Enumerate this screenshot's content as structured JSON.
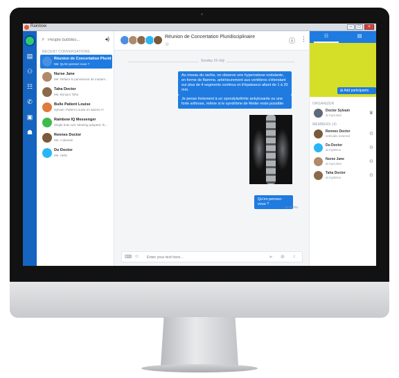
{
  "window": {
    "title": "Rainbow"
  },
  "sidebar": {
    "search_placeholder": "People bubbles...",
    "section_label": "RECENT CONVERSATIONS",
    "conversations": [
      {
        "name": "Réunion de Concertation Plurid",
        "preview": "Me: Qu'en pensez-vous ?",
        "active": true,
        "color": "#4a90e2"
      },
      {
        "name": "Nurse Jane",
        "preview": "Me: Refaire le pansement de madam...",
        "color": "#b08a6b"
      },
      {
        "name": "Taha Doctor",
        "preview": "Me: Bonjour Taha",
        "color": "#8a6a4a"
      },
      {
        "name": "Bulle Patient Louise",
        "preview": "Sylvain: Patient Louise en alarme !!!",
        "color": "#e07a3f"
      },
      {
        "name": "Rainbow IQ Messenger",
        "preview": "Single bots nuh: Meeting adopted, th...",
        "color": "#3fb950"
      },
      {
        "name": "Rennes Doctor",
        "preview": "Me: A demain",
        "color": "#7a5a3a"
      },
      {
        "name": "Du Doctor",
        "preview": "Me: Hello",
        "color": "#29b6f6"
      }
    ]
  },
  "chat": {
    "title": "Réunion de Concertation Pluridisciplinaire",
    "date": "Sunday 19 July",
    "messages": [
      "Au niveau du rachis, on observe une hyperostose ondulante, en forme de flamme, antérieurement aux vertèbres s'étendant sur plus de 4 segments continus et d'épaisseur allant de 1 à 20 mm.",
      "Je pense fortement à un spondylarthrite ankylosante ou une forte arthrose, même si le syndrôme de Reiter reste possible",
      "Qu'en pensez-vous ?"
    ],
    "timestamp": "11:13 PM",
    "composer_placeholder": "Enter your text here..."
  },
  "info": {
    "add_participants": "Add participants",
    "organizer_label": "ORGANIZER",
    "organizer": {
      "name": "Doctor Sylvain",
      "status": "at mycustor",
      "color": "#5b6b7b"
    },
    "members_label": "MEMBERS (4)",
    "members": [
      {
        "name": "Rennes Doctor",
        "status": "verticalis external",
        "color": "#7a5a3a"
      },
      {
        "name": "Du Doctor",
        "status": "at mydemo",
        "color": "#29b6f6"
      },
      {
        "name": "Nurse Jane",
        "status": "at mycustor",
        "color": "#b08a6b"
      },
      {
        "name": "Taha Doctor",
        "status": "at mydemo",
        "color": "#8a6a4a"
      }
    ]
  },
  "colors": {
    "rail": "#1565c0",
    "accent": "#1f7be0",
    "banner": "#d6df28"
  }
}
